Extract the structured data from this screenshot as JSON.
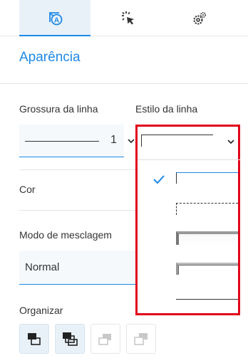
{
  "tabs": [
    {
      "name": "appearance-icon",
      "active": true
    },
    {
      "name": "cursor-click-icon",
      "active": false
    },
    {
      "name": "settings-gear-icon",
      "active": false
    }
  ],
  "section": {
    "title": "Aparência"
  },
  "line_thickness": {
    "label": "Grossura da linha",
    "value": "1"
  },
  "line_style": {
    "label": "Estilo da linha",
    "options": [
      "solid",
      "dashed",
      "inset",
      "outset",
      "bottom-only"
    ],
    "selected_index": 0
  },
  "color": {
    "label": "Cor"
  },
  "blend": {
    "label": "Modo de mesclagem",
    "value": "Normal"
  },
  "arrange": {
    "label": "Organizar",
    "buttons": [
      {
        "name": "bring-forward-icon",
        "enabled": true
      },
      {
        "name": "bring-to-front-icon",
        "enabled": true
      },
      {
        "name": "send-backward-icon",
        "enabled": false
      },
      {
        "name": "send-to-back-icon",
        "enabled": false
      }
    ]
  },
  "colors": {
    "accent": "#1e88e5",
    "highlight_border": "#e0001b",
    "tab_active_bg": "#e9f1f8"
  }
}
